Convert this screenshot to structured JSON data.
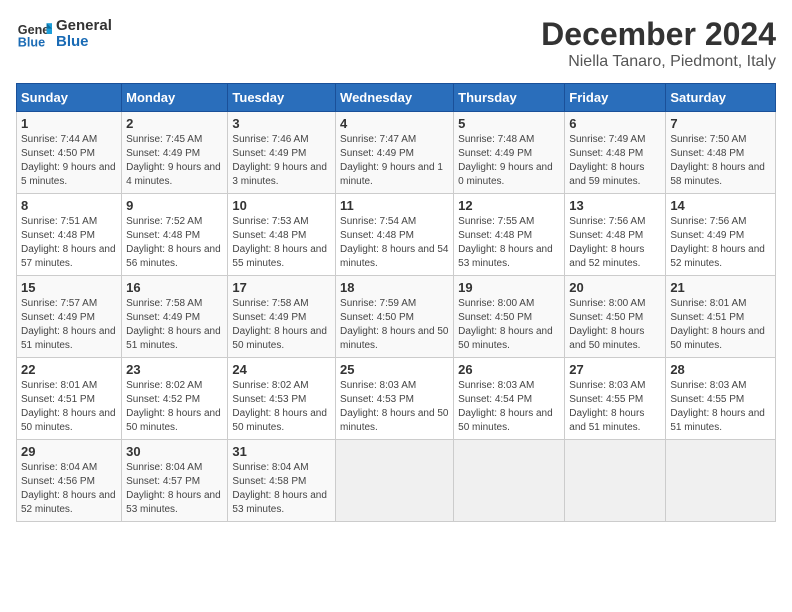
{
  "logo": {
    "line1": "General",
    "line2": "Blue"
  },
  "title": "December 2024",
  "subtitle": "Niella Tanaro, Piedmont, Italy",
  "days_of_week": [
    "Sunday",
    "Monday",
    "Tuesday",
    "Wednesday",
    "Thursday",
    "Friday",
    "Saturday"
  ],
  "weeks": [
    [
      {
        "day": "1",
        "info": "Sunrise: 7:44 AM\nSunset: 4:50 PM\nDaylight: 9 hours and 5 minutes."
      },
      {
        "day": "2",
        "info": "Sunrise: 7:45 AM\nSunset: 4:49 PM\nDaylight: 9 hours and 4 minutes."
      },
      {
        "day": "3",
        "info": "Sunrise: 7:46 AM\nSunset: 4:49 PM\nDaylight: 9 hours and 3 minutes."
      },
      {
        "day": "4",
        "info": "Sunrise: 7:47 AM\nSunset: 4:49 PM\nDaylight: 9 hours and 1 minute."
      },
      {
        "day": "5",
        "info": "Sunrise: 7:48 AM\nSunset: 4:49 PM\nDaylight: 9 hours and 0 minutes."
      },
      {
        "day": "6",
        "info": "Sunrise: 7:49 AM\nSunset: 4:48 PM\nDaylight: 8 hours and 59 minutes."
      },
      {
        "day": "7",
        "info": "Sunrise: 7:50 AM\nSunset: 4:48 PM\nDaylight: 8 hours and 58 minutes."
      }
    ],
    [
      {
        "day": "8",
        "info": "Sunrise: 7:51 AM\nSunset: 4:48 PM\nDaylight: 8 hours and 57 minutes."
      },
      {
        "day": "9",
        "info": "Sunrise: 7:52 AM\nSunset: 4:48 PM\nDaylight: 8 hours and 56 minutes."
      },
      {
        "day": "10",
        "info": "Sunrise: 7:53 AM\nSunset: 4:48 PM\nDaylight: 8 hours and 55 minutes."
      },
      {
        "day": "11",
        "info": "Sunrise: 7:54 AM\nSunset: 4:48 PM\nDaylight: 8 hours and 54 minutes."
      },
      {
        "day": "12",
        "info": "Sunrise: 7:55 AM\nSunset: 4:48 PM\nDaylight: 8 hours and 53 minutes."
      },
      {
        "day": "13",
        "info": "Sunrise: 7:56 AM\nSunset: 4:48 PM\nDaylight: 8 hours and 52 minutes."
      },
      {
        "day": "14",
        "info": "Sunrise: 7:56 AM\nSunset: 4:49 PM\nDaylight: 8 hours and 52 minutes."
      }
    ],
    [
      {
        "day": "15",
        "info": "Sunrise: 7:57 AM\nSunset: 4:49 PM\nDaylight: 8 hours and 51 minutes."
      },
      {
        "day": "16",
        "info": "Sunrise: 7:58 AM\nSunset: 4:49 PM\nDaylight: 8 hours and 51 minutes."
      },
      {
        "day": "17",
        "info": "Sunrise: 7:58 AM\nSunset: 4:49 PM\nDaylight: 8 hours and 50 minutes."
      },
      {
        "day": "18",
        "info": "Sunrise: 7:59 AM\nSunset: 4:50 PM\nDaylight: 8 hours and 50 minutes."
      },
      {
        "day": "19",
        "info": "Sunrise: 8:00 AM\nSunset: 4:50 PM\nDaylight: 8 hours and 50 minutes."
      },
      {
        "day": "20",
        "info": "Sunrise: 8:00 AM\nSunset: 4:50 PM\nDaylight: 8 hours and 50 minutes."
      },
      {
        "day": "21",
        "info": "Sunrise: 8:01 AM\nSunset: 4:51 PM\nDaylight: 8 hours and 50 minutes."
      }
    ],
    [
      {
        "day": "22",
        "info": "Sunrise: 8:01 AM\nSunset: 4:51 PM\nDaylight: 8 hours and 50 minutes."
      },
      {
        "day": "23",
        "info": "Sunrise: 8:02 AM\nSunset: 4:52 PM\nDaylight: 8 hours and 50 minutes."
      },
      {
        "day": "24",
        "info": "Sunrise: 8:02 AM\nSunset: 4:53 PM\nDaylight: 8 hours and 50 minutes."
      },
      {
        "day": "25",
        "info": "Sunrise: 8:03 AM\nSunset: 4:53 PM\nDaylight: 8 hours and 50 minutes."
      },
      {
        "day": "26",
        "info": "Sunrise: 8:03 AM\nSunset: 4:54 PM\nDaylight: 8 hours and 50 minutes."
      },
      {
        "day": "27",
        "info": "Sunrise: 8:03 AM\nSunset: 4:55 PM\nDaylight: 8 hours and 51 minutes."
      },
      {
        "day": "28",
        "info": "Sunrise: 8:03 AM\nSunset: 4:55 PM\nDaylight: 8 hours and 51 minutes."
      }
    ],
    [
      {
        "day": "29",
        "info": "Sunrise: 8:04 AM\nSunset: 4:56 PM\nDaylight: 8 hours and 52 minutes."
      },
      {
        "day": "30",
        "info": "Sunrise: 8:04 AM\nSunset: 4:57 PM\nDaylight: 8 hours and 53 minutes."
      },
      {
        "day": "31",
        "info": "Sunrise: 8:04 AM\nSunset: 4:58 PM\nDaylight: 8 hours and 53 minutes."
      },
      {
        "day": "",
        "info": ""
      },
      {
        "day": "",
        "info": ""
      },
      {
        "day": "",
        "info": ""
      },
      {
        "day": "",
        "info": ""
      }
    ]
  ]
}
